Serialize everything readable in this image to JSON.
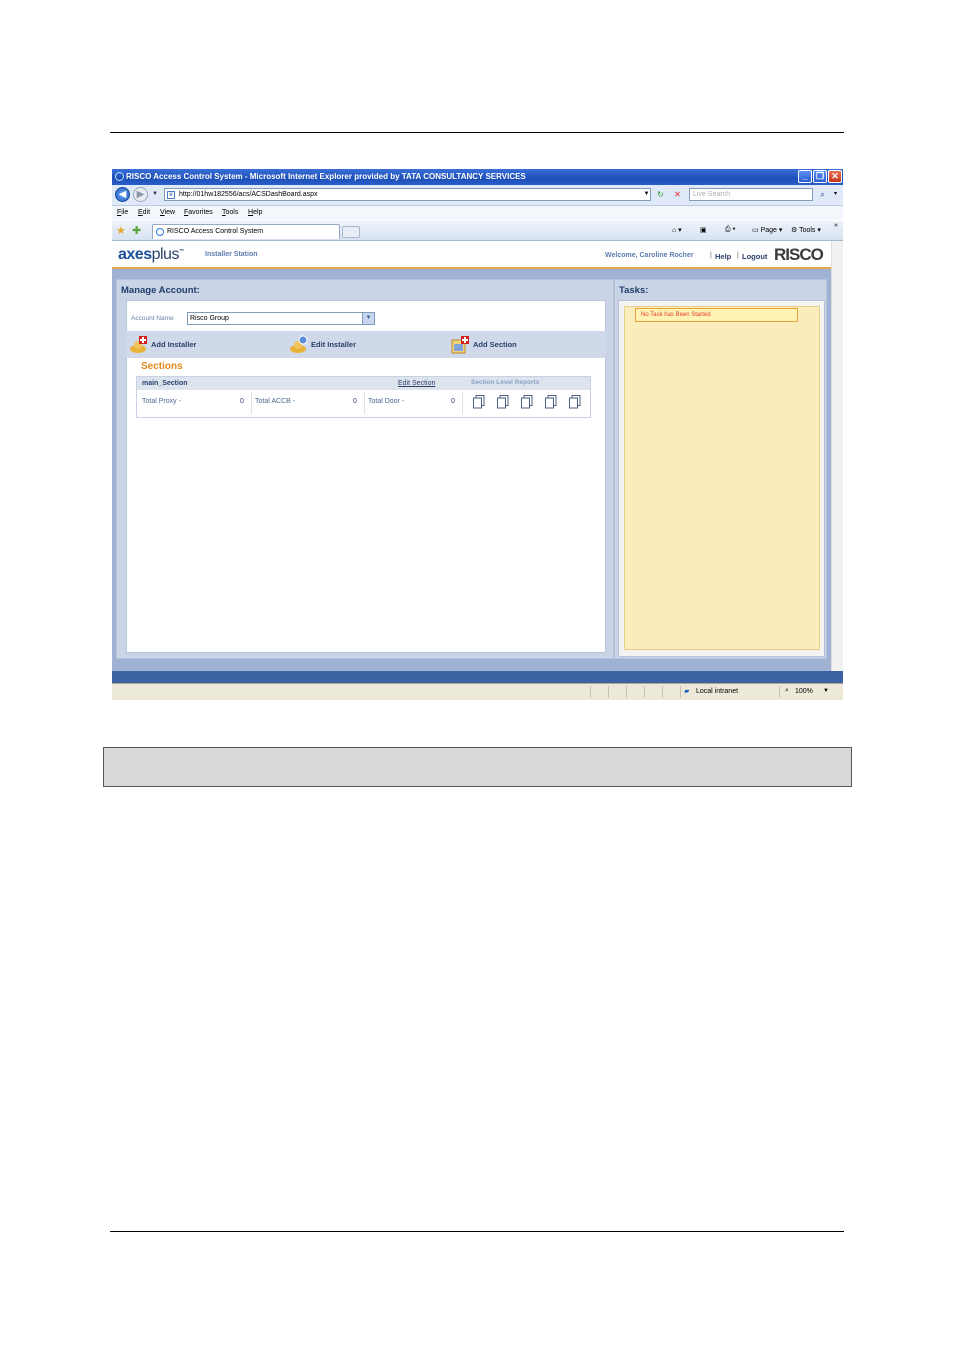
{
  "window": {
    "title": "RISCO Access Control System - Microsoft Internet Explorer provided by TATA CONSULTANCY SERVICES",
    "min_glyph": "_",
    "max_glyph": "❐",
    "close_glyph": "✕"
  },
  "browser": {
    "url": "http://01hw182556/acs/ACSDashBoard.aspx",
    "search_placeholder": "Live Search",
    "menu": [
      "File",
      "Edit",
      "View",
      "Favorites",
      "Tools",
      "Help"
    ],
    "tab_title": "RISCO Access Control System",
    "commands": {
      "page": "Page",
      "tools": "Tools"
    },
    "status": {
      "zone": "Local intranet",
      "zoom": "100%"
    }
  },
  "app": {
    "logo_axes": "axes",
    "logo_plus": "plus",
    "logo_tm": "™",
    "station": "Installer Station",
    "welcome": "Welcome,  Caroline Rocher",
    "help": "Help",
    "logout": "Logout",
    "brand": "RISCO",
    "separator": "|"
  },
  "manage": {
    "title": "Manage Account:",
    "account_label": "Account Name",
    "account_value": "Risco Group",
    "actions": {
      "add_installer": "Add Installer",
      "edit_installer": "Edit Installer",
      "add_section": "Add Section"
    },
    "sections_title": "Sections",
    "section": {
      "name": "main_Section",
      "edit": "Edit Section",
      "reports_label": "Section Level Reports",
      "stats": [
        {
          "label": "Total Proxy -",
          "value": "0"
        },
        {
          "label": "Total ACCB -",
          "value": "0"
        },
        {
          "label": "Total Door -",
          "value": "0"
        }
      ],
      "report_icons": [
        "report-icon",
        "report-icon",
        "report-icon",
        "report-icon",
        "report-icon"
      ]
    }
  },
  "tasks": {
    "title": "Tasks:",
    "note": "No Task has Been Started"
  },
  "colors": {
    "accent": "#e38a1a",
    "panel": "#c9d4e7",
    "task_bg": "#fbedbb",
    "frame": "#9fb2d3"
  }
}
